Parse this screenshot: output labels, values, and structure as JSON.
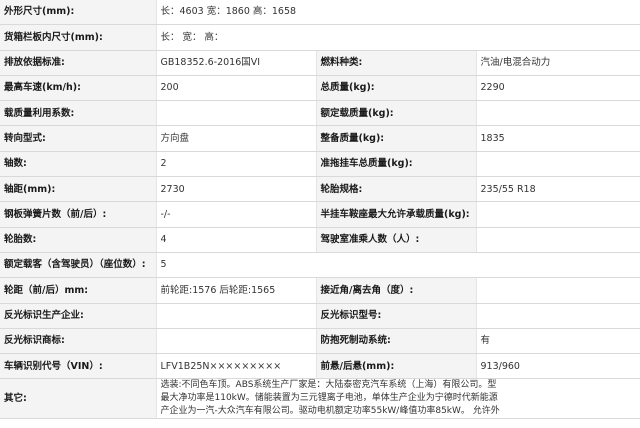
{
  "rows": [
    {
      "l_label": "外形尺寸(mm):",
      "l_value": "长：4603 宽：1860 高：1658"
    },
    {
      "l_label": "货箱栏板内尺寸(mm):",
      "l_value": "长： 宽： 高："
    },
    {
      "l_label": "排放依据标准:",
      "l_value": "GB18352.6-2016国VI",
      "r_label": "燃料种类:",
      "r_value": "汽油/电混合动力"
    },
    {
      "l_label": "最高车速(km/h):",
      "l_value": "200",
      "r_label": "总质量(kg):",
      "r_value": "2290"
    },
    {
      "l_label": "载质量利用系数:",
      "l_value": "",
      "r_label": "额定载质量(kg):",
      "r_value": ""
    },
    {
      "l_label": "转向型式:",
      "l_value": "方向盘",
      "r_label": "整备质量(kg):",
      "r_value": "1835"
    },
    {
      "l_label": "轴数:",
      "l_value": "2",
      "r_label": "准拖挂车总质量(kg):",
      "r_value": ""
    },
    {
      "l_label": "轴距(mm):",
      "l_value": "2730",
      "r_label": "轮胎规格:",
      "r_value": "235/55 R18"
    },
    {
      "l_label": "钢板弹簧片数（前/后）:",
      "l_value": "-/-",
      "r_label": "半挂车鞍座最大允许承载质量(kg):",
      "r_value": ""
    },
    {
      "l_label": "轮胎数:",
      "l_value": "4",
      "r_label": "驾驶室准乘人数（人）:",
      "r_value": ""
    },
    {
      "l_label": "额定载客（含驾驶员）（座位数）:",
      "l_value": "5"
    },
    {
      "l_label": "轮距（前/后）mm:",
      "l_value": "前轮距:1576 后轮距:1565",
      "r_label": "接近角/离去角（度）:",
      "r_value": ""
    },
    {
      "l_label": "反光标识生产企业:",
      "l_value": "",
      "r_label": "反光标识型号:",
      "r_value": ""
    },
    {
      "l_label": "反光标识商标:",
      "l_value": "",
      "r_label": "防抱死制动系统:",
      "r_value": "有"
    },
    {
      "l_label": "车辆识别代号（VIN）:",
      "l_value": "LFV1B25N×××××××××",
      "r_label": "前悬/后悬(mm):",
      "r_value": "913/960"
    }
  ],
  "other": {
    "label": "其它:",
    "line1": "选装:不同色车顶。ABS系统生产厂家是：大陆泰密克汽车系统（上海）有限公司。型",
    "line2": "最大净功率是110kW。储能装置为三元锂离子电池，单体生产企业为宁德时代新能源",
    "line3": "产企业为一汽-大众汽车有限公司。驱动电机额定功率55kW/峰值功率85kW。 允许外"
  }
}
